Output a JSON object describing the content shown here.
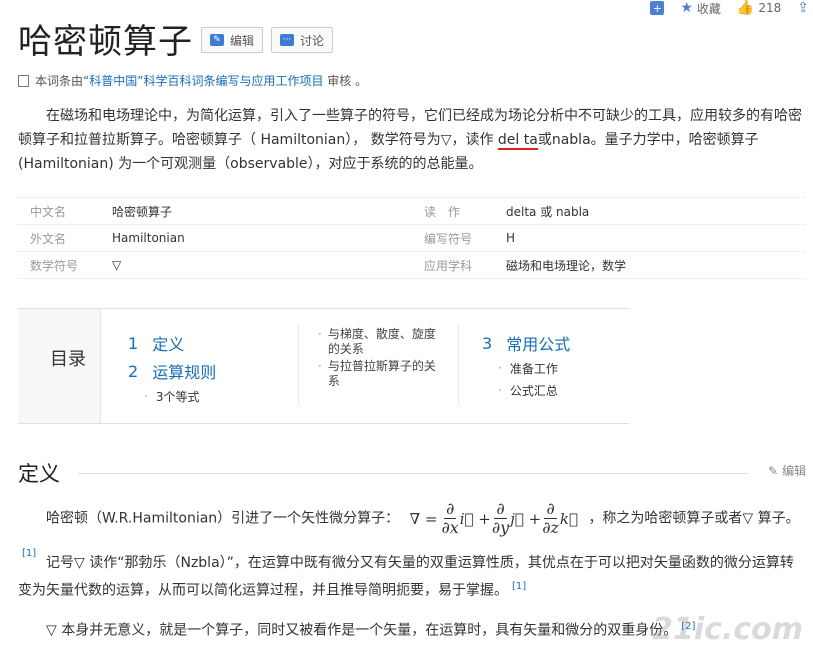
{
  "topbar": {
    "favorite_label": "收藏",
    "like_count": "218"
  },
  "title": "哈密顿算子",
  "buttons": {
    "edit": "编辑",
    "discuss": "讨论"
  },
  "review": {
    "prefix": "本词条由",
    "link": "“科普中国”科学百科词条编写与应用工作项目",
    "suffix": "审核 。"
  },
  "intro": {
    "p1a": "在磁场和电场理论中，为简化运算，引入了一些算子的符号，它们已经成为场论分析中不可缺少的工具，应用较多的有哈密顿算子和拉普拉斯算子。哈密顿算子（ Hamiltonian）， 数学符号为▽，读作 ",
    "p1u": "del ta",
    "p1b": "或nabla。量子力学中，哈密顿算子(Hamiltonian) 为一个可观测量（observable），对应于系统的的总能量。"
  },
  "info": [
    {
      "k1": "中文名",
      "v1": "哈密顿算子",
      "k2": "读　作",
      "v2": "delta 或 nabla"
    },
    {
      "k1": "外文名",
      "v1": "Hamiltonian",
      "k2": "编写符号",
      "v2": "H"
    },
    {
      "k1": "数学符号",
      "v1": "▽",
      "k2": "应用学科",
      "v2": "磁场和电场理论，数学"
    }
  ],
  "toc": {
    "label": "目录",
    "items": [
      {
        "num": "1",
        "label": "定义"
      },
      {
        "num": "2",
        "label": "运算规则"
      },
      {
        "num": "3",
        "label": "常用公式"
      }
    ],
    "sub2": [
      "3个等式"
    ],
    "mid": [
      "与梯度、散度、旋度的关系",
      "与拉普拉斯算子的关系"
    ],
    "sub3": [
      "准备工作",
      "公式汇总"
    ]
  },
  "section": {
    "title": "定义",
    "edit": "编辑"
  },
  "body": {
    "p1_pre": "哈密顿（W.R.Hamiltonian）引进了一个矢性微分算子：",
    "p1_post": "，称之为哈密顿算子或者▽ 算子。",
    "p1_ref": "[1]",
    "p2": "记号▽ 读作“那勃乐（Nzbla）”，在运算中既有微分又有矢量的双重运算性质，其优点在于可以把对矢量函数的微分运算转变为矢量代数的运算，从而可以简化运算过程，并且推导简明扼要，易于掌握。",
    "p2_ref": "[1]",
    "p3": "▽ 本身并无意义，就是一个算子，同时又被看作是一个矢量，在运算时，具有矢量和微分的双重身份。",
    "p3_ref": "[2]"
  },
  "watermark": "21ic.com"
}
